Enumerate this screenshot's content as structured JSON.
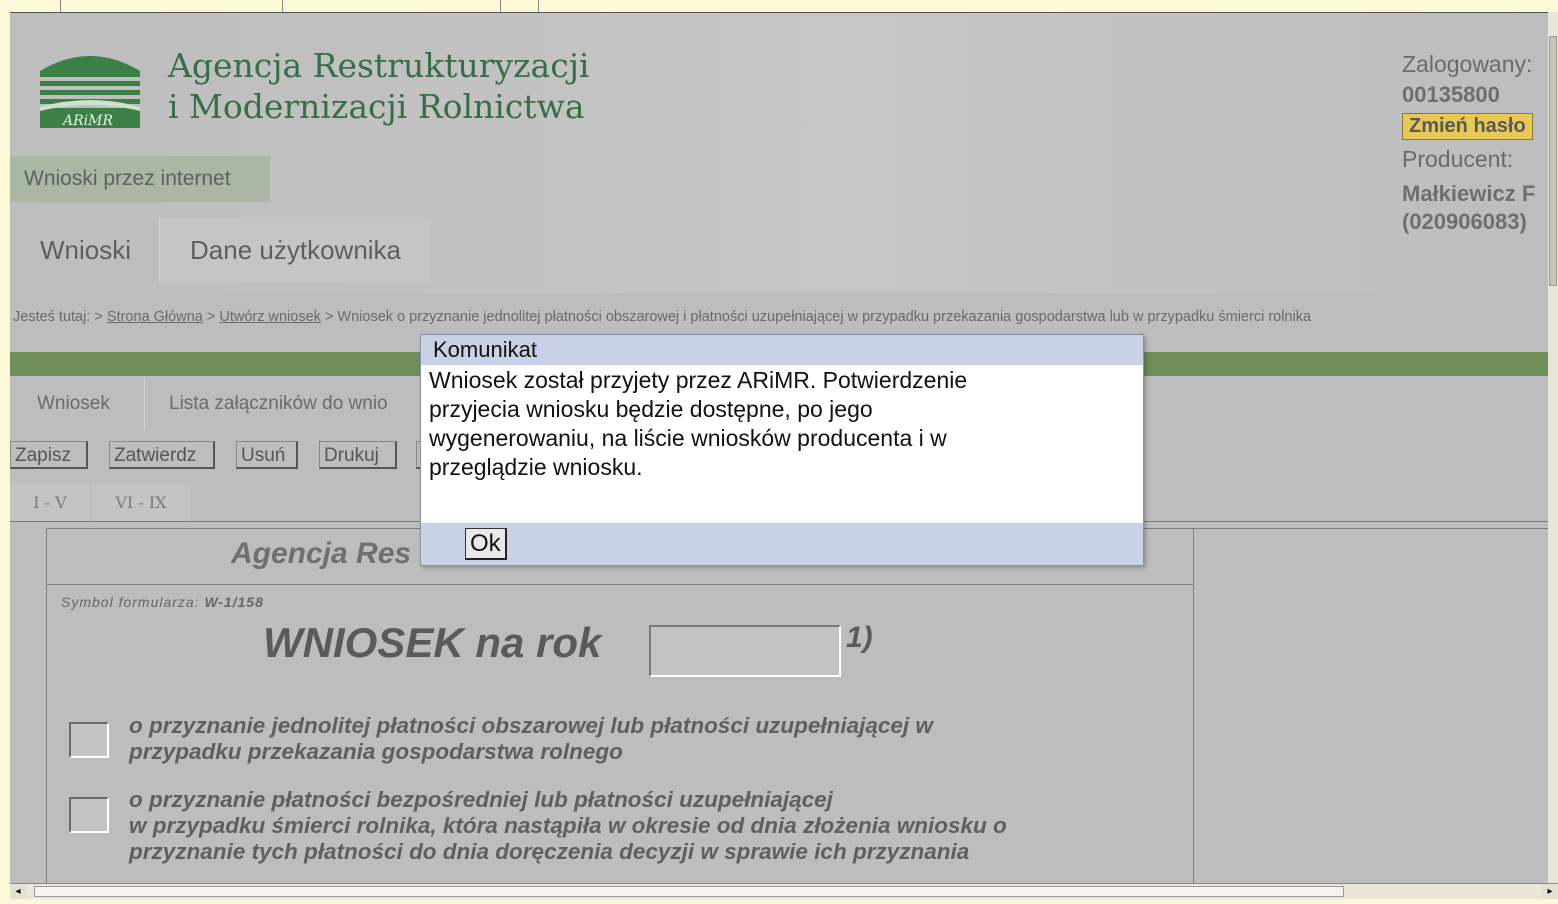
{
  "logo": {
    "text": "ARiMR"
  },
  "agency": {
    "line1": "Agencja Restrukturyzacji",
    "line2": "i Modernizacji Rolnictwa"
  },
  "service_tab": "Wnioski przez internet",
  "main_tabs": [
    "Wnioski",
    "Dane użytkownika"
  ],
  "user": {
    "logged_label": "Zalogowany:",
    "logged_value": "00135800",
    "change_password": "Zmień hasło",
    "producer_label": "Producent:",
    "producer_name": "Małkiewicz F",
    "producer_id": "(020906083)"
  },
  "breadcrumb": {
    "prefix": "Jesteś tutaj:",
    "sep": ">",
    "home": "Strona Główna",
    "create": "Utwórz wniosek",
    "current": "Wniosek o przyznanie jednolitej płatności obszarowej i płatności uzupełniającej w przypadku przekazania gospodarstwa lub w przypadku śmierci rolnika"
  },
  "sub_tabs": [
    "Wniosek",
    "Lista załączników do wnio"
  ],
  "toolbar": [
    "Zapisz",
    "Zatwierdz",
    "Usuń",
    "Drukuj"
  ],
  "section_tabs": [
    "I - V",
    "VI - IX"
  ],
  "form": {
    "title": "Agencja Res",
    "symbol_label": "Symbol formularza:",
    "symbol_value": "W-1/158",
    "heading": "WNIOSEK na rok",
    "year_value": "",
    "footnote": "1)",
    "option1": [
      "o przyznanie jednolitej płatności obszarowej lub płatności uzupełniającej w",
      "przypadku przekazania gospodarstwa rolnego"
    ],
    "option2": [
      "o przyznanie płatności bezpośredniej lub płatności uzupełniającej",
      "w przypadku śmierci rolnika, która nastąpiła w okresie od dnia złożenia wniosku o",
      "przyznanie tych płatności do dnia doręczenia decyzji w sprawie ich przyznania"
    ]
  },
  "dialog": {
    "title": "Komunikat",
    "message": [
      "Wniosek został przyjety przez ARiMR. Potwierdzenie",
      "przyjecia wniosku będzie dostępne, po jego",
      "wygenerowaniu, na liście wniosków producenta i w",
      "przeglądzie wniosku."
    ],
    "ok_label": "Ok"
  },
  "colors": {
    "agency_green": "#366f45",
    "status_bar": "#6e8f5a",
    "dialog_bar": "#c9d1e6",
    "password_button": "#e8c957"
  }
}
